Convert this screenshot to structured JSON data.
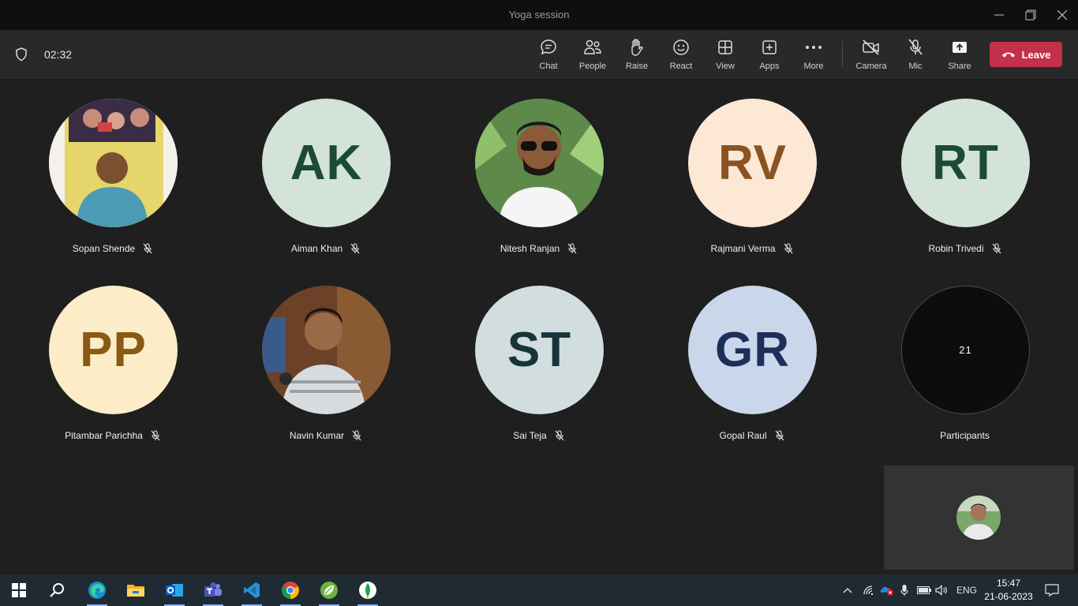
{
  "window": {
    "title": "Yoga session"
  },
  "toolbar": {
    "timer": "02:32",
    "buttons": [
      {
        "label": "Chat",
        "icon": "chat-icon"
      },
      {
        "label": "People",
        "icon": "people-icon"
      },
      {
        "label": "Raise",
        "icon": "raise-hand-icon"
      },
      {
        "label": "React",
        "icon": "smiley-icon"
      },
      {
        "label": "View",
        "icon": "grid-icon"
      },
      {
        "label": "Apps",
        "icon": "apps-plus-icon"
      },
      {
        "label": "More",
        "icon": "more-dots-icon"
      },
      {
        "label": "Camera",
        "icon": "camera-off-icon"
      },
      {
        "label": "Mic",
        "icon": "mic-off-icon"
      },
      {
        "label": "Share",
        "icon": "share-screen-icon"
      }
    ],
    "leave_label": "Leave"
  },
  "participants": [
    {
      "name": "Sopan Shende",
      "initials": "",
      "type": "photo"
    },
    {
      "name": "Aiman Khan",
      "initials": "AK",
      "bg": "#d3e3d8",
      "fg": "#1d4a35"
    },
    {
      "name": "Nitesh Ranjan",
      "initials": "",
      "type": "photo"
    },
    {
      "name": "Rajmani Verma",
      "initials": "RV",
      "bg": "#fde8d5",
      "fg": "#8a5323"
    },
    {
      "name": "Robin Trivedi",
      "initials": "RT",
      "bg": "#d3e3d8",
      "fg": "#1d4a35"
    },
    {
      "name": "Pitambar Parichha",
      "initials": "PP",
      "bg": "#fcecc8",
      "fg": "#8a5a13"
    },
    {
      "name": "Navin Kumar",
      "initials": "",
      "type": "photo"
    },
    {
      "name": "Sai Teja",
      "initials": "ST",
      "bg": "#d2dde0",
      "fg": "#17343a"
    },
    {
      "name": "Gopal Raul",
      "initials": "GR",
      "bg": "#cad6ea",
      "fg": "#1c2f5a"
    }
  ],
  "overflow": {
    "count": "21",
    "label": "Participants"
  },
  "taskbar": {
    "apps": [
      "windows-start-icon",
      "search-icon",
      "edge-icon",
      "file-explorer-icon",
      "outlook-icon",
      "teams-icon",
      "vscode-icon",
      "chrome-icon",
      "spring-icon",
      "mongodb-icon"
    ],
    "language": "ENG",
    "time": "15:47",
    "date": "21-06-2023"
  }
}
